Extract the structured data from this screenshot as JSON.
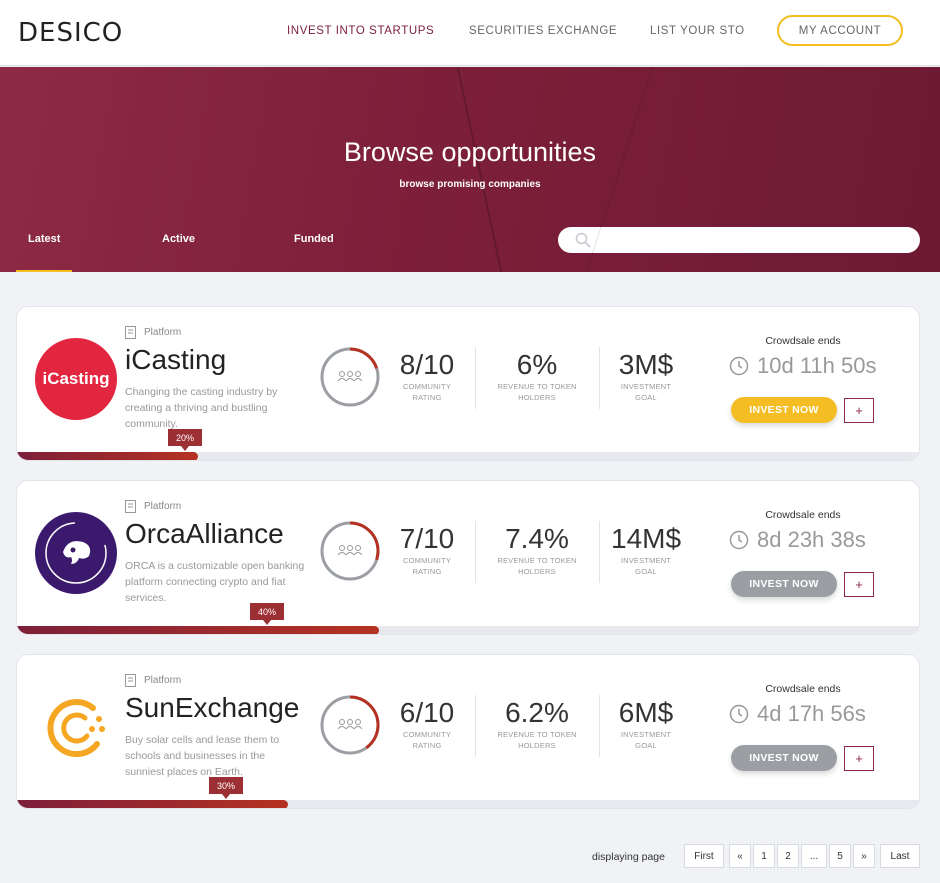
{
  "header": {
    "logo": "DESICO",
    "nav": [
      "INVEST INTO STARTUPS",
      "SECURITIES EXCHANGE",
      "LIST YOUR STO"
    ],
    "account": "MY ACCOUNT"
  },
  "hero": {
    "title": "Browse opportunities",
    "subtitle": "browse promising companies",
    "tabs": [
      "Latest",
      "Active",
      "Funded"
    ],
    "search_placeholder": ""
  },
  "cards": [
    {
      "category": "Platform",
      "name": "iCasting",
      "description": "Changing the casting industry by creating a thriving and bustling community.",
      "rating": "8/10",
      "rating_label": "COMMUNITY RATING",
      "rating_fraction": 0.8,
      "revenue": "6%",
      "revenue_label": "REVENUE TO TOKEN HOLDERS",
      "goal": "3M$",
      "goal_label": "INVESTMENT GOAL",
      "ends_label": "Crowdsale ends",
      "countdown": "10d 11h 50s",
      "invest": "INVEST NOW",
      "invest_style": "yellow",
      "plus": "+",
      "progress": 0.2,
      "progress_label": "20%",
      "logo_text": "iCasting",
      "logo_color": "#e3263f"
    },
    {
      "category": "Platform",
      "name": "OrcaAlliance",
      "description": "ORCA is a customizable open banking platform connecting crypto and fiat services.",
      "rating": "7/10",
      "rating_label": "COMMUNITY RATING",
      "rating_fraction": 0.7,
      "revenue": "7.4%",
      "revenue_label": "REVENUE TO TOKEN HOLDERS",
      "goal": "14M$",
      "goal_label": "INVESTMENT GOAL",
      "ends_label": "Crowdsale ends",
      "countdown": "8d 23h 38s",
      "invest": "INVEST NOW",
      "invest_style": "grey",
      "plus": "+",
      "progress": 0.4,
      "progress_label": "40%",
      "logo_color": "#3b1a6e"
    },
    {
      "category": "Platform",
      "name": "SunExchange",
      "description": "Buy solar cells and lease them to schools and businesses in the sunniest places on Earth.",
      "rating": "6/10",
      "rating_label": "COMMUNITY RATING",
      "rating_fraction": 0.6,
      "revenue": "6.2%",
      "revenue_label": "REVENUE TO TOKEN HOLDERS",
      "goal": "6M$",
      "goal_label": "INVESTMENT GOAL",
      "ends_label": "Crowdsale ends",
      "countdown": "4d 17h 56s",
      "invest": "INVEST NOW",
      "invest_style": "grey",
      "plus": "+",
      "progress": 0.3,
      "progress_label": "30%",
      "logo_color": "#f5a623"
    }
  ],
  "pagination": {
    "label": "displaying page",
    "buttons": [
      "First",
      "«",
      "1",
      "2",
      "...",
      "5",
      "»",
      "Last"
    ]
  }
}
